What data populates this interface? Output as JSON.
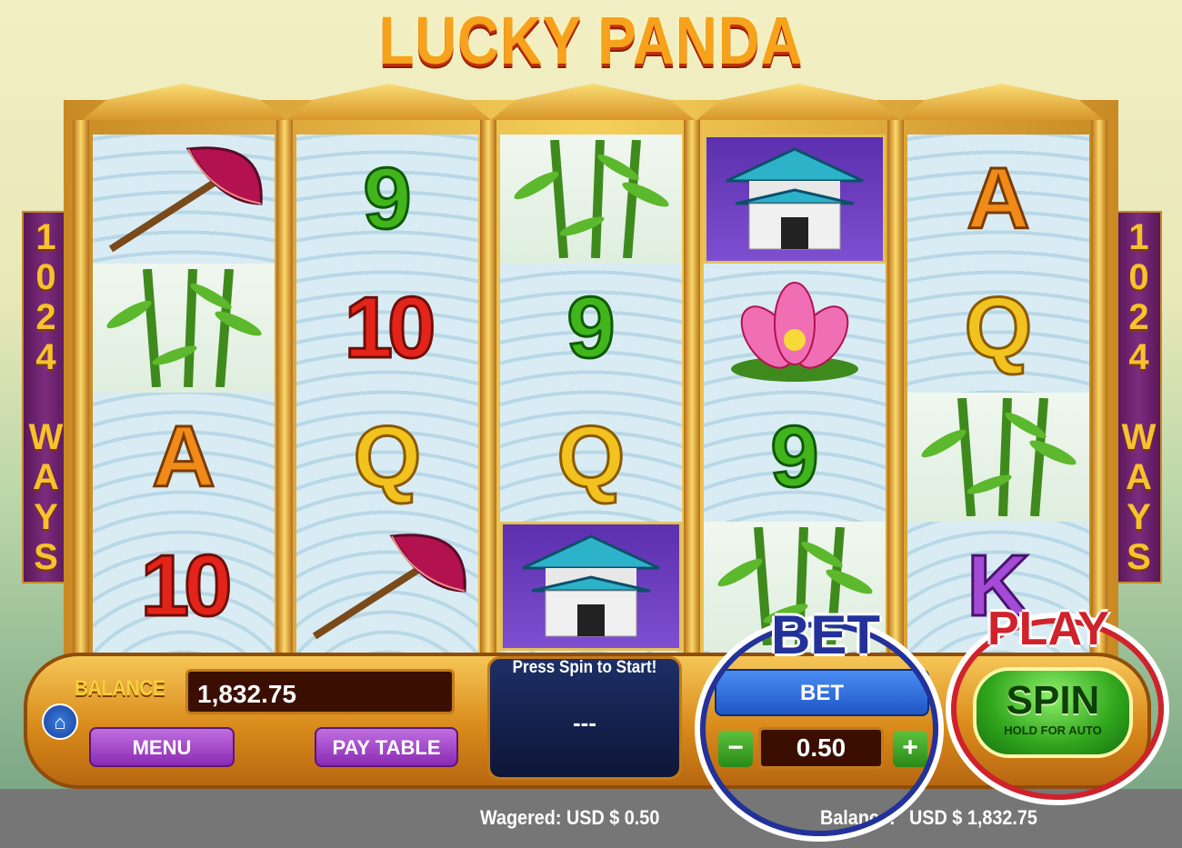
{
  "game": {
    "title": "LUCKY PANDA"
  },
  "ways_banner": {
    "left_text": "1024 WAYS",
    "right_text": "1024 WAYS"
  },
  "reels": [
    {
      "symbols": [
        "umbrella",
        "bamboo",
        "A",
        "10"
      ]
    },
    {
      "symbols": [
        "9",
        "10",
        "Q",
        "umbrella"
      ]
    },
    {
      "symbols": [
        "bamboo",
        "9",
        "Q",
        "temple"
      ]
    },
    {
      "symbols": [
        "temple",
        "lotus",
        "9",
        "bamboo"
      ]
    },
    {
      "symbols": [
        "A",
        "Q",
        "bamboo",
        "K"
      ]
    }
  ],
  "panel": {
    "balance_label": "BALANCE",
    "balance_value": "1,832.75",
    "menu_label": "MENU",
    "paytable_label": "PAY TABLE",
    "message": "Press Spin to Start!",
    "message_value": "---",
    "bet_label": "BET",
    "bet_value": "0.50",
    "minus": "−",
    "plus": "+",
    "spin_label": "SPIN",
    "spin_sub": "HOLD FOR AUTO"
  },
  "status_bar": {
    "wagered": "Wagered:  USD $ 0.50",
    "balance": "USD $ 1,832.75",
    "balance_prefix": "Balance:"
  },
  "annotations": {
    "bet": "BET",
    "play": "PLAY"
  },
  "colors": {
    "accent_gold": "#f5cf5b",
    "bet_ring": "#23329a",
    "play_ring": "#d0222b",
    "spin_green": "#2fa51c"
  }
}
